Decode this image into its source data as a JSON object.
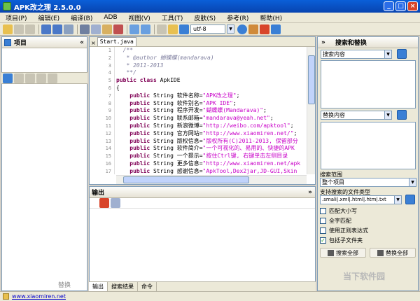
{
  "window": {
    "title": "APK改之理 2.5.0.0"
  },
  "menu": [
    "项目(P)",
    "编辑(E)",
    "编译(B)",
    "ADB",
    "视图(V)",
    "工具(T)",
    "皮肤(S)",
    "参考(R)",
    "帮助(H)"
  ],
  "toolbar": {
    "encoding": "utf-8"
  },
  "left_panel": {
    "title": "项目",
    "replace_button": "替换"
  },
  "editor": {
    "tab": "Start.java",
    "line_numbers": [
      "1",
      "2",
      "3",
      "4",
      "5",
      "6",
      "7",
      "8",
      "9",
      "10",
      "11",
      "12",
      "13",
      "14",
      "15",
      "16",
      "17"
    ],
    "lines": [
      [
        {
          "t": "  /**",
          "c": "cm"
        }
      ],
      [
        {
          "t": "   * @author 蝴蝶蝶(mandarava)",
          "c": "cm"
        }
      ],
      [
        {
          "t": "   * 2011-2013",
          "c": "cm"
        }
      ],
      [
        {
          "t": "   **/",
          "c": "cm"
        }
      ],
      [
        {
          "t": "public class ",
          "c": "kw"
        },
        {
          "t": "ApkIDE",
          "c": ""
        }
      ],
      [
        {
          "t": "{",
          "c": ""
        }
      ],
      [
        {
          "t": "    public ",
          "c": "kw"
        },
        {
          "t": "String 软件名称=",
          "c": ""
        },
        {
          "t": "\"APK改之理\"",
          "c": "str"
        },
        {
          "t": ";",
          "c": ""
        }
      ],
      [
        {
          "t": "    public ",
          "c": "kw"
        },
        {
          "t": "String 软件别名=",
          "c": ""
        },
        {
          "t": "\"APK IDE\"",
          "c": "str"
        },
        {
          "t": ";",
          "c": ""
        }
      ],
      [
        {
          "t": "    public ",
          "c": "kw"
        },
        {
          "t": "String 程序开发=",
          "c": ""
        },
        {
          "t": "\"蝴蝶蝶(Mandarava)\"",
          "c": "str"
        },
        {
          "t": ";",
          "c": ""
        }
      ],
      [
        {
          "t": "    public ",
          "c": "kw"
        },
        {
          "t": "String 联系邮箱=",
          "c": ""
        },
        {
          "t": "\"mandarava@yeah.net\"",
          "c": "str"
        },
        {
          "t": ";",
          "c": ""
        }
      ],
      [
        {
          "t": "    public ",
          "c": "kw"
        },
        {
          "t": "String 新浪微博=",
          "c": ""
        },
        {
          "t": "\"http://weibo.com/apktool\"",
          "c": "str"
        },
        {
          "t": ";",
          "c": ""
        }
      ],
      [
        {
          "t": "    public ",
          "c": "kw"
        },
        {
          "t": "String 官方网站=",
          "c": ""
        },
        {
          "t": "\"http://www.xiaomiren.net/\"",
          "c": "str"
        },
        {
          "t": ";",
          "c": ""
        }
      ],
      [
        {
          "t": "    public ",
          "c": "kw"
        },
        {
          "t": "String 版权信息=",
          "c": ""
        },
        {
          "t": "\"版权所有(C)2011-2013, 保留部分",
          "c": "str"
        }
      ],
      [
        {
          "t": "    public ",
          "c": "kw"
        },
        {
          "t": "String 软件简介=",
          "c": ""
        },
        {
          "t": "\"一个可视化的、易用的、快捷的APK",
          "c": "str"
        }
      ],
      [
        {
          "t": "    public ",
          "c": "kw"
        },
        {
          "t": "String 一个提示=",
          "c": ""
        },
        {
          "t": "\"按住Ctrl键, 右键单击左侧目录",
          "c": "str"
        }
      ],
      [
        {
          "t": "    public ",
          "c": "kw"
        },
        {
          "t": "String 更多信息=",
          "c": ""
        },
        {
          "t": "\"http://www.xiaomiren.net/apk",
          "c": "str"
        }
      ],
      [
        {
          "t": "    public ",
          "c": "kw"
        },
        {
          "t": "String 感谢信息=",
          "c": ""
        },
        {
          "t": "\"ApkTool,Dex2jar,JD-GUI,Skin",
          "c": "str"
        }
      ],
      [
        {
          "t": "}",
          "c": ""
        }
      ]
    ]
  },
  "output": {
    "title": "输出",
    "tabs": [
      "输出",
      "搜索结果",
      "命令"
    ]
  },
  "search_panel": {
    "title": "搜索和替换",
    "search_label": "搜索内容",
    "replace_label": "替换内容",
    "scope_label": "搜索范围",
    "scope_value": "整个项目",
    "filetypes_label": "支持搜索的文件类型",
    "filetypes_value": ".smali|.xml|.html|.htm|.txt",
    "options": [
      {
        "label": "匹配大小写",
        "checked": false
      },
      {
        "label": "全字匹配",
        "checked": false
      },
      {
        "label": "使用正则表达式",
        "checked": false
      },
      {
        "label": "包括子文件夹",
        "checked": true
      }
    ],
    "search_all": "搜索全部",
    "replace_all": "替换全部"
  },
  "status": {
    "link": "www.xiaomiren.net"
  },
  "watermark": "当下软件园",
  "colors": {
    "titlebar": "#0a5fd8",
    "accent": "#3a7fd5",
    "keyword": "#7f0055",
    "string": "#c800c8",
    "comment": "#7f7f9f"
  }
}
